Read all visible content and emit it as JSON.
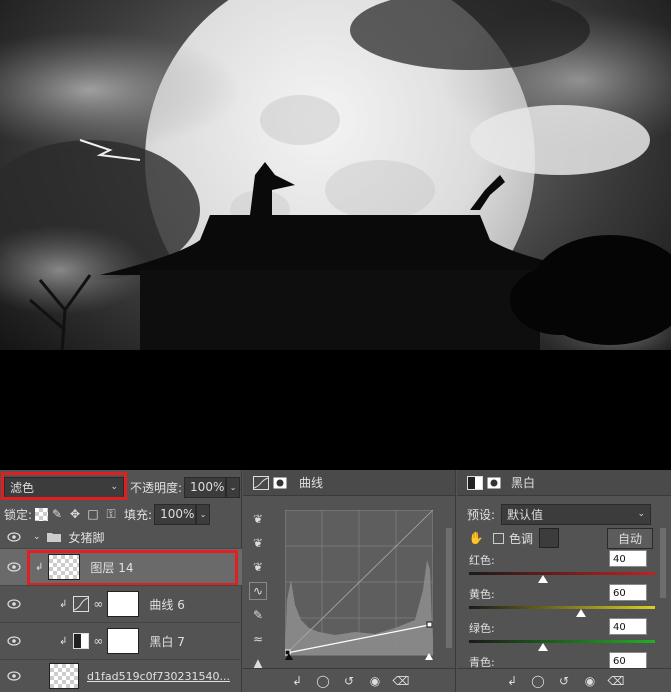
{
  "layers_panel": {
    "blend_mode": "滤色",
    "opacity_label": "不透明度:",
    "opacity_value": "100%",
    "lock_label": "锁定:",
    "fill_label": "填充:",
    "fill_value": "100%",
    "group_name": "女猪脚",
    "layers": [
      {
        "name": "图层 14"
      },
      {
        "name": "曲线 6"
      },
      {
        "name": "黑白 7"
      },
      {
        "name": "d1fad519c0f730231540..."
      }
    ]
  },
  "properties_panel": {
    "title": "曲线"
  },
  "bw_panel": {
    "title": "黑白",
    "preset_label": "预设:",
    "preset_value": "默认值",
    "tint_label": "色调",
    "auto_button": "自动",
    "sliders": [
      {
        "label": "红色:",
        "value": "40",
        "pct": 0.4,
        "gradient": "red"
      },
      {
        "label": "黄色:",
        "value": "60",
        "pct": 0.6,
        "gradient": "yellow"
      },
      {
        "label": "绿色:",
        "value": "40",
        "pct": 0.4,
        "gradient": "green"
      },
      {
        "label": "青色:",
        "value": "60",
        "pct": 0.6,
        "gradient": "cyan"
      }
    ]
  },
  "colors": {
    "highlight": "#e02020",
    "panel_bg": "#535353",
    "field_bg": "#3c3c3c"
  }
}
